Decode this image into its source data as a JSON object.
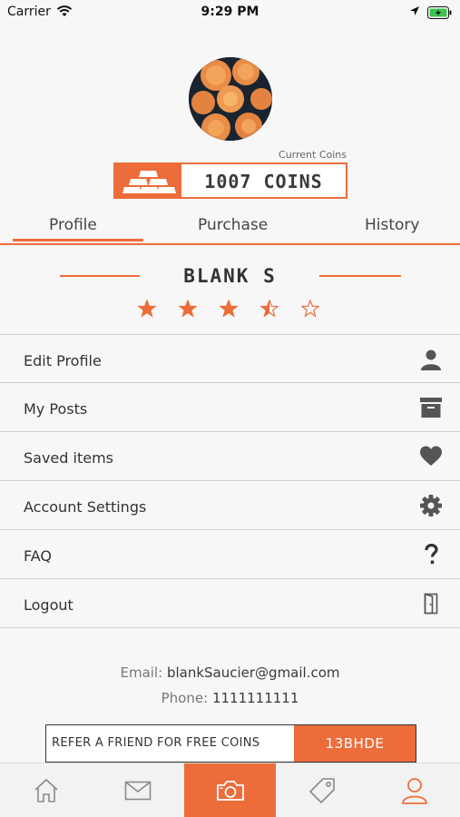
{
  "status_bar": {
    "carrier": "Carrier",
    "time": "9:29 PM"
  },
  "colors": {
    "accent": "#ec6d3a",
    "text": "#3a3a3a",
    "divider": "#cfcfcf"
  },
  "coins": {
    "caption": "Current Coins",
    "value": "1007 COINS",
    "icon": "gold-bars-icon"
  },
  "tabs": [
    {
      "label": "Profile",
      "active": true
    },
    {
      "label": "Purchase",
      "active": false
    },
    {
      "label": "History",
      "active": false
    }
  ],
  "user": {
    "name": "BLANK S",
    "rating": 3.5,
    "rating_max": 5
  },
  "menu": [
    {
      "label": "Edit Profile",
      "icon": "person-icon"
    },
    {
      "label": "My Posts",
      "icon": "archive-icon"
    },
    {
      "label": "Saved items",
      "icon": "heart-icon"
    },
    {
      "label": "Account Settings",
      "icon": "gear-icon"
    },
    {
      "label": "FAQ",
      "icon": "question-icon"
    },
    {
      "label": "Logout",
      "icon": "door-icon"
    }
  ],
  "contact": {
    "email_label": "Email:",
    "email": "blankSaucier@gmail.com",
    "phone_label": "Phone:",
    "phone": "1111111111"
  },
  "referral": {
    "text": "REFER A FRIEND FOR FREE COINS",
    "code": "13BHDE"
  },
  "tab_bar": [
    {
      "icon": "home-icon",
      "active": false
    },
    {
      "icon": "mail-icon",
      "active": false
    },
    {
      "icon": "camera-icon",
      "active": false
    },
    {
      "icon": "tag-icon",
      "active": false
    },
    {
      "icon": "person-icon",
      "active": true
    }
  ]
}
